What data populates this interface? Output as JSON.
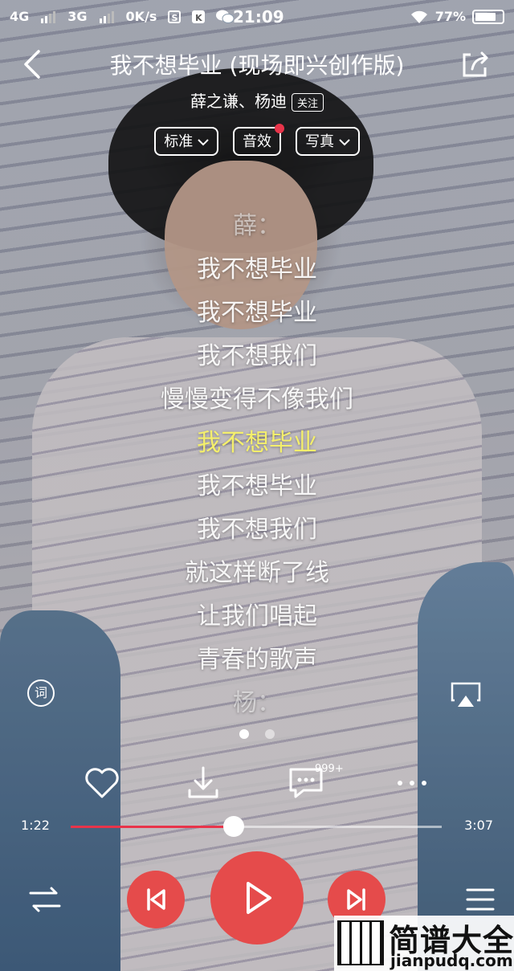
{
  "status_bar": {
    "network1": "4G",
    "network2": "3G",
    "speed": "0K/s",
    "s_icon": "S",
    "k_icon": "K",
    "time": "21:09",
    "battery": "77%"
  },
  "header": {
    "title": "我不想毕业 (现场即兴创作版)",
    "artists": "薛之谦、杨迪",
    "follow_label": "关注"
  },
  "pills": [
    {
      "label": "标准",
      "has_dropdown": true
    },
    {
      "label": "音效",
      "has_dropdown": false,
      "dot": true
    },
    {
      "label": "写真",
      "has_dropdown": true
    }
  ],
  "lyrics": [
    {
      "text": "薛：",
      "state": "dim"
    },
    {
      "text": "我不想毕业",
      "state": "normal"
    },
    {
      "text": "我不想毕业",
      "state": "normal"
    },
    {
      "text": "我不想我们",
      "state": "normal"
    },
    {
      "text": "慢慢变得不像我们",
      "state": "normal"
    },
    {
      "text": "我不想毕业",
      "state": "active"
    },
    {
      "text": "我不想毕业",
      "state": "normal"
    },
    {
      "text": "我不想我们",
      "state": "normal"
    },
    {
      "text": "就这样断了线",
      "state": "normal"
    },
    {
      "text": "让我们唱起",
      "state": "normal"
    },
    {
      "text": "青春的歌声",
      "state": "normal"
    },
    {
      "text": "杨：",
      "state": "dim"
    }
  ],
  "lyric_icon_label": "词",
  "comment_count": "999+",
  "playback": {
    "elapsed": "1:22",
    "total": "3:07",
    "progress_fraction": 0.44
  },
  "watermark": {
    "name": "简谱大全",
    "url": "jianpudq.com"
  },
  "colors": {
    "accent_red": "#e54b4b",
    "active_lyric": "#f4ef6c"
  }
}
